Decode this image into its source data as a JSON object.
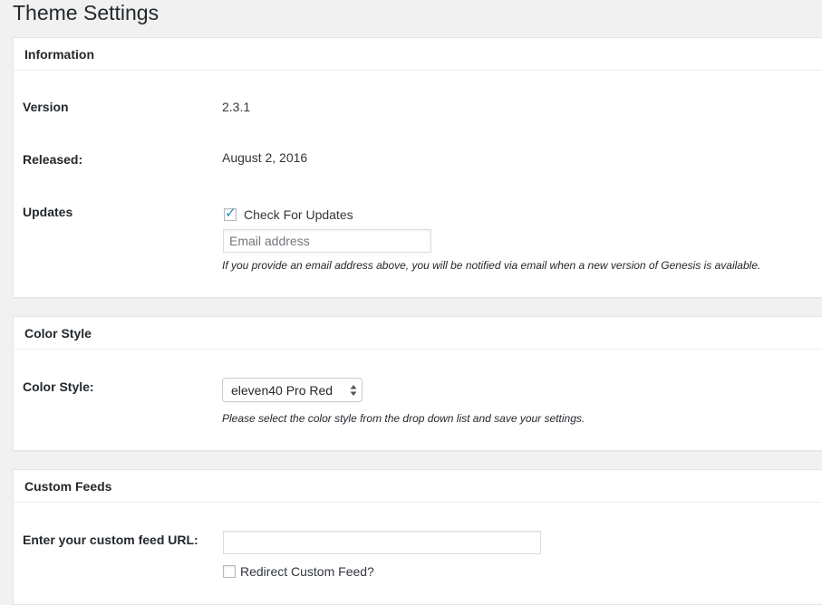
{
  "page": {
    "title": "Theme Settings"
  },
  "information": {
    "heading": "Information",
    "version_label": "Version",
    "version_value": "2.3.1",
    "released_label": "Released:",
    "released_value": "August 2, 2016",
    "updates_label": "Updates",
    "check_updates_label": "Check For Updates",
    "check_updates_checked": true,
    "email_placeholder": "Email address",
    "email_value": "",
    "email_description": "If you provide an email address above, you will be notified via email when a new version of Genesis is available."
  },
  "color_style": {
    "heading": "Color Style",
    "label": "Color Style:",
    "selected": "eleven40 Pro Red",
    "description": "Please select the color style from the drop down list and save your settings."
  },
  "custom_feeds": {
    "heading": "Custom Feeds",
    "feed_url_label": "Enter your custom feed URL:",
    "feed_url_value": "",
    "redirect_label": "Redirect Custom Feed?",
    "redirect_checked": false
  },
  "colors": {
    "background": "#f1f1f1",
    "panel": "#ffffff",
    "check_accent": "#1e8cbe"
  }
}
